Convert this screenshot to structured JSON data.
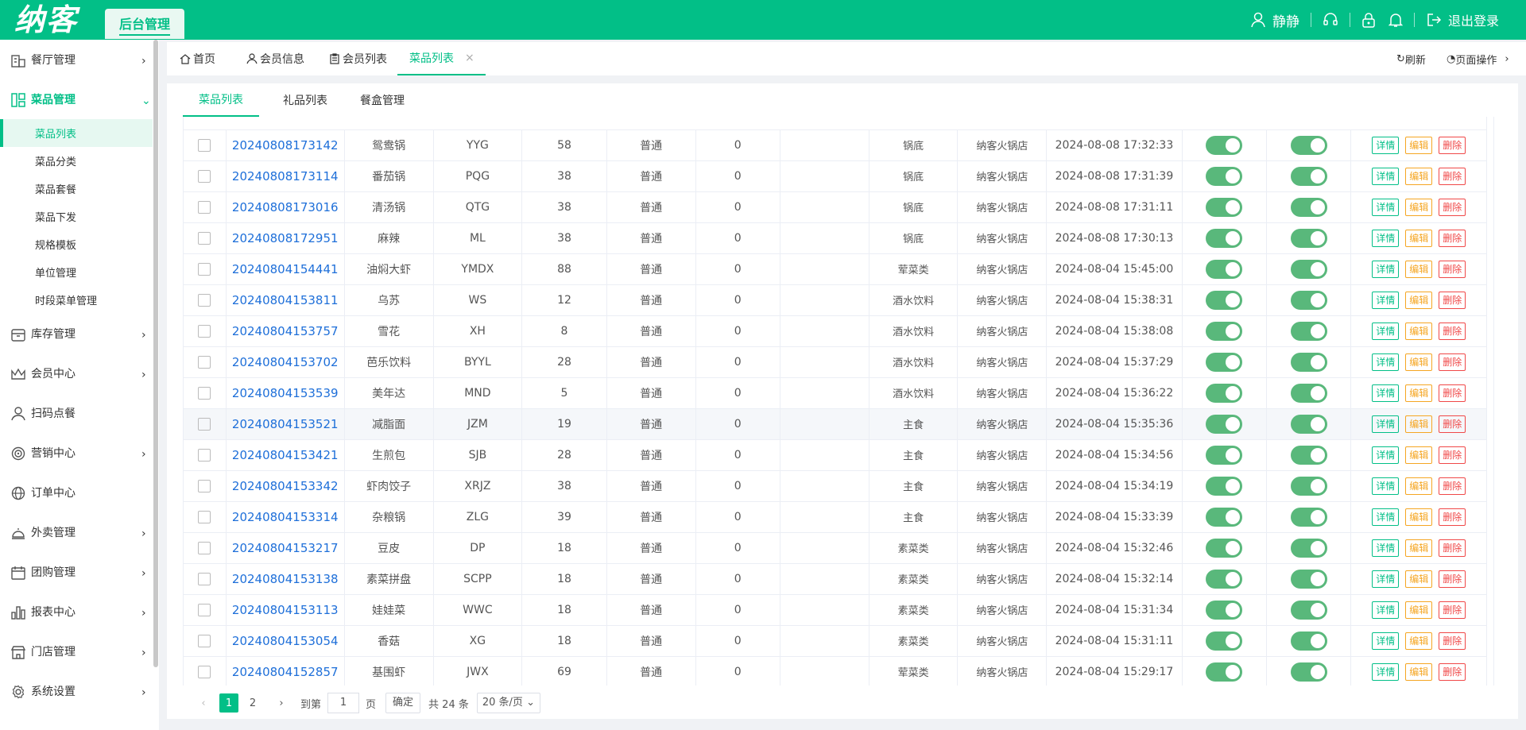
{
  "header": {
    "logo": "纳客",
    "admin_tab": "后台管理",
    "user_name": "静静",
    "logout": "退出登录"
  },
  "sidebar": {
    "restaurant": "餐厅管理",
    "dishes": "菜品管理",
    "sub_items": [
      "菜品列表",
      "菜品分类",
      "菜品套餐",
      "菜品下发",
      "规格模板",
      "单位管理",
      "时段菜单管理"
    ],
    "inventory": "库存管理",
    "member": "会员中心",
    "scan": "扫码点餐",
    "marketing": "营销中心",
    "orders": "订单中心",
    "takeout": "外卖管理",
    "groupbuy": "团购管理",
    "reports": "报表中心",
    "stores": "门店管理",
    "settings": "系统设置"
  },
  "page_tabs": {
    "home": "首页",
    "member_info": "会员信息",
    "member_list": "会员列表",
    "dish_list": "菜品列表",
    "close": "×",
    "refresh": "刷新",
    "page_ops": "页面操作"
  },
  "sub_tabs": [
    "菜品列表",
    "礼品列表",
    "餐盒管理"
  ],
  "table": {
    "rows": [
      {
        "code": "20240808173142",
        "name": "鸳鸯锅",
        "abbr": "YYG",
        "price": "58",
        "type": "普通",
        "stock": "0",
        "extra": "",
        "cat": "锅底",
        "store": "纳客火锅店",
        "time": "2024-08-08 17:32:33"
      },
      {
        "code": "20240808173114",
        "name": "番茄锅",
        "abbr": "PQG",
        "price": "38",
        "type": "普通",
        "stock": "0",
        "extra": "",
        "cat": "锅底",
        "store": "纳客火锅店",
        "time": "2024-08-08 17:31:39"
      },
      {
        "code": "20240808173016",
        "name": "清汤锅",
        "abbr": "QTG",
        "price": "38",
        "type": "普通",
        "stock": "0",
        "extra": "",
        "cat": "锅底",
        "store": "纳客火锅店",
        "time": "2024-08-08 17:31:11"
      },
      {
        "code": "20240808172951",
        "name": "麻辣",
        "abbr": "ML",
        "price": "38",
        "type": "普通",
        "stock": "0",
        "extra": "",
        "cat": "锅底",
        "store": "纳客火锅店",
        "time": "2024-08-08 17:30:13"
      },
      {
        "code": "20240804154441",
        "name": "油焖大虾",
        "abbr": "YMDX",
        "price": "88",
        "type": "普通",
        "stock": "0",
        "extra": "",
        "cat": "荤菜类",
        "store": "纳客火锅店",
        "time": "2024-08-04 15:45:00"
      },
      {
        "code": "20240804153811",
        "name": "乌苏",
        "abbr": "WS",
        "price": "12",
        "type": "普通",
        "stock": "0",
        "extra": "",
        "cat": "酒水饮料",
        "store": "纳客火锅店",
        "time": "2024-08-04 15:38:31"
      },
      {
        "code": "20240804153757",
        "name": "雪花",
        "abbr": "XH",
        "price": "8",
        "type": "普通",
        "stock": "0",
        "extra": "",
        "cat": "酒水饮料",
        "store": "纳客火锅店",
        "time": "2024-08-04 15:38:08"
      },
      {
        "code": "20240804153702",
        "name": "芭乐饮料",
        "abbr": "BYYL",
        "price": "28",
        "type": "普通",
        "stock": "0",
        "extra": "",
        "cat": "酒水饮料",
        "store": "纳客火锅店",
        "time": "2024-08-04 15:37:29"
      },
      {
        "code": "20240804153539",
        "name": "美年达",
        "abbr": "MND",
        "price": "5",
        "type": "普通",
        "stock": "0",
        "extra": "",
        "cat": "酒水饮料",
        "store": "纳客火锅店",
        "time": "2024-08-04 15:36:22"
      },
      {
        "code": "20240804153521",
        "name": "减脂面",
        "abbr": "JZM",
        "price": "19",
        "type": "普通",
        "stock": "0",
        "extra": "",
        "cat": "主食",
        "store": "纳客火锅店",
        "time": "2024-08-04 15:35:36"
      },
      {
        "code": "20240804153421",
        "name": "生煎包",
        "abbr": "SJB",
        "price": "28",
        "type": "普通",
        "stock": "0",
        "extra": "",
        "cat": "主食",
        "store": "纳客火锅店",
        "time": "2024-08-04 15:34:56"
      },
      {
        "code": "20240804153342",
        "name": "虾肉饺子",
        "abbr": "XRJZ",
        "price": "38",
        "type": "普通",
        "stock": "0",
        "extra": "",
        "cat": "主食",
        "store": "纳客火锅店",
        "time": "2024-08-04 15:34:19"
      },
      {
        "code": "20240804153314",
        "name": "杂粮锅",
        "abbr": "ZLG",
        "price": "39",
        "type": "普通",
        "stock": "0",
        "extra": "",
        "cat": "主食",
        "store": "纳客火锅店",
        "time": "2024-08-04 15:33:39"
      },
      {
        "code": "20240804153217",
        "name": "豆皮",
        "abbr": "DP",
        "price": "18",
        "type": "普通",
        "stock": "0",
        "extra": "",
        "cat": "素菜类",
        "store": "纳客火锅店",
        "time": "2024-08-04 15:32:46"
      },
      {
        "code": "20240804153138",
        "name": "素菜拼盘",
        "abbr": "SCPP",
        "price": "18",
        "type": "普通",
        "stock": "0",
        "extra": "",
        "cat": "素菜类",
        "store": "纳客火锅店",
        "time": "2024-08-04 15:32:14"
      },
      {
        "code": "20240804153113",
        "name": "娃娃菜",
        "abbr": "WWC",
        "price": "18",
        "type": "普通",
        "stock": "0",
        "extra": "",
        "cat": "素菜类",
        "store": "纳客火锅店",
        "time": "2024-08-04 15:31:34"
      },
      {
        "code": "20240804153054",
        "name": "香菇",
        "abbr": "XG",
        "price": "18",
        "type": "普通",
        "stock": "0",
        "extra": "",
        "cat": "素菜类",
        "store": "纳客火锅店",
        "time": "2024-08-04 15:31:11"
      },
      {
        "code": "20240804152857",
        "name": "基围虾",
        "abbr": "JWX",
        "price": "69",
        "type": "普通",
        "stock": "0",
        "extra": "",
        "cat": "荤菜类",
        "store": "纳客火锅店",
        "time": "2024-08-04 15:29:17"
      }
    ],
    "actions": {
      "detail": "详情",
      "edit": "编辑",
      "delete": "删除"
    }
  },
  "pager": {
    "page1": "1",
    "page2": "2",
    "goto": "到第",
    "page_input": "1",
    "page_unit": "页",
    "confirm": "确定",
    "total": "共 24 条",
    "page_size": "20 条/页"
  }
}
